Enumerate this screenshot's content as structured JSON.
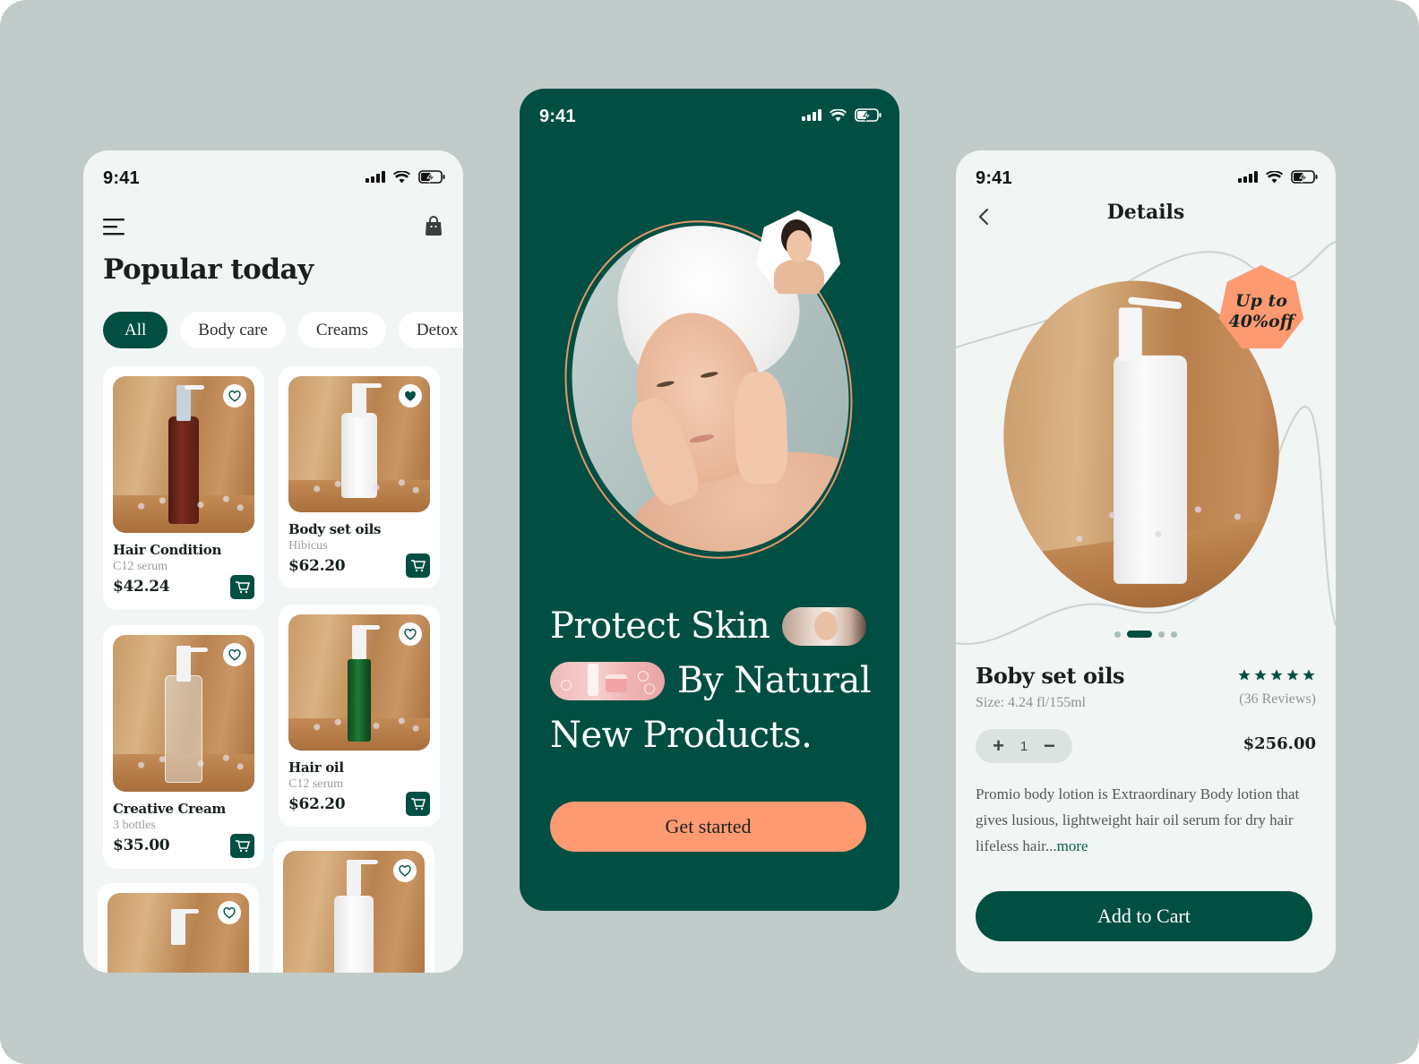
{
  "colors": {
    "background": "#c1cbc9",
    "brand_green": "#004f42",
    "accent_orange": "#fe9a71",
    "screen_light": "#f1f5f4"
  },
  "status_bar": {
    "time": "9:41",
    "icons": [
      "signal-icon",
      "wifi-icon",
      "battery-charging-icon"
    ]
  },
  "listing_screen": {
    "title": "Popular today",
    "icons": {
      "menu": "menu-icon",
      "bag": "shopping-bag-icon"
    },
    "categories": [
      {
        "label": "All",
        "active": true
      },
      {
        "label": "Body care",
        "active": false
      },
      {
        "label": "Creams",
        "active": false
      },
      {
        "label": "Detox fa",
        "active": false
      }
    ],
    "products": [
      {
        "name": "Hair Condition",
        "subtitle": "C12 serum",
        "price": "$42.24",
        "favorited": false,
        "bottle": "amber"
      },
      {
        "name": "Body set oils",
        "subtitle": "Hibicus",
        "price": "$62.20",
        "favorited": true,
        "bottle": "white"
      },
      {
        "name": "Creative Cream",
        "subtitle": "3 bottles",
        "price": "$35.00",
        "favorited": false,
        "bottle": "clear"
      },
      {
        "name": "Hair oil",
        "subtitle": "C12 serum",
        "price": "$62.20",
        "favorited": false,
        "bottle": "green"
      },
      {
        "name": "",
        "subtitle": "",
        "price": "",
        "favorited": false,
        "bottle": "green"
      },
      {
        "name": "",
        "subtitle": "",
        "price": "",
        "favorited": false,
        "bottle": "white"
      }
    ]
  },
  "onboarding_screen": {
    "headline": {
      "line1": "Protect Skin",
      "line2": "By Natural",
      "line3": "New Products."
    },
    "cta_label": "Get started"
  },
  "details_screen": {
    "title": "Details",
    "discount_badge": {
      "line1": "Up to",
      "line2": "40%off"
    },
    "carousel": {
      "count": 4,
      "active_index": 1
    },
    "product_name": "Boby set oils",
    "size": "Size: 4.24 fl/155ml",
    "rating": {
      "stars": 5,
      "max": 5,
      "reviews": "(36 Reviews)"
    },
    "quantity": {
      "increment": "+",
      "value": "1",
      "decrement": "−"
    },
    "price": "$256.00",
    "description": "Promio body lotion is Extraordinary Body lotion that gives lusious, lightweight hair oil serum for dry hair lifeless hair...",
    "more_link": "more",
    "add_to_cart_label": "Add to Cart"
  }
}
